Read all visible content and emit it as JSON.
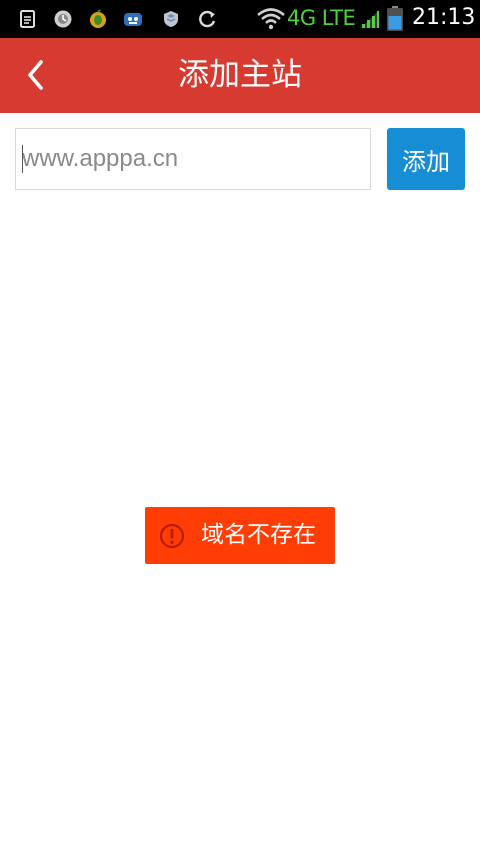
{
  "status_bar": {
    "network": "4G LTE",
    "time": "21:13",
    "icons": [
      "document-icon",
      "clock-app-icon",
      "fruit-app-icon",
      "dog-app-icon",
      "shield-app-icon",
      "sync-icon",
      "wifi-icon",
      "signal-icon",
      "battery-icon"
    ],
    "network_color": "#4fd03c"
  },
  "header": {
    "title": "添加主站",
    "back_icon": "chevron-left-icon",
    "color": "#d63a31"
  },
  "form": {
    "input_value": "",
    "input_placeholder": "www.apppa.cn",
    "add_label": "添加",
    "add_color": "#168dd4"
  },
  "toast": {
    "icon": "error-circle-icon",
    "message": "域名不存在",
    "color": "#ff3d05"
  }
}
